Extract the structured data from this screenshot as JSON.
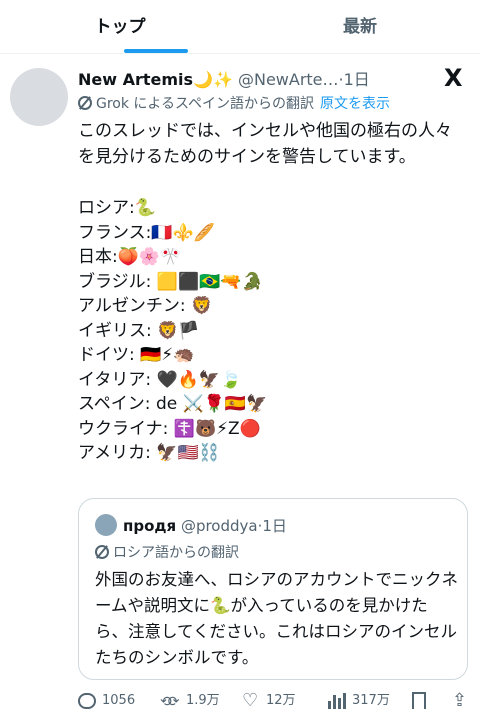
{
  "tabs": {
    "active": "トップ",
    "inactive": "最新"
  },
  "tweet": {
    "display_name": "New Artemis",
    "name_emoji": "🌙✨",
    "handle": "@NewArte…",
    "time": "·1日",
    "translate_label": "Grok によるスペイン語からの翻訳",
    "show_original": "原文を表示",
    "intro": "このスレッドでは、インセルや他国の極右の人々を見分けるためのサインを警告しています。",
    "signs": [
      "ロシア:🐍",
      "フランス:🇫🇷⚜️🥖",
      "日本:🍑🌸🎌",
      "ブラジル: 🟨⬛🇧🇷🔫🐊",
      "アルゼンチン: 🦁",
      "イギリス: 🦁🏴",
      "ドイツ: 🇩🇪⚡🦔",
      "イタリア: 🖤🔥🦅🍃",
      "スペイン: de ⚔️🌹🇪🇸🦅",
      "ウクライナ: ☦️🐻⚡Z🔴",
      "アメリカ: 🦅🇺🇸⛓️"
    ]
  },
  "quote": {
    "display_name": "продя",
    "handle": "@proddya",
    "time": "·1日",
    "translate_label": "ロシア語からの翻訳",
    "text": "外国のお友達へ、ロシアのアカウントでニックネームや説明文に🐍が入っているのを見かけたら、注意してください。これはロシアのインセルたちのシンボルです。"
  },
  "actions": {
    "replies": "1056",
    "reposts": "1.9万",
    "likes": "12万",
    "views": "317万"
  },
  "icons": {
    "logo": "X",
    "reply": "reply-icon",
    "repost": "repost-icon",
    "like": "heart-icon",
    "views": "views-icon",
    "bookmark": "bookmark-icon",
    "share": "share-icon"
  },
  "colors": {
    "accent": "#1d9bf0",
    "muted": "#536471",
    "text": "#0f1419"
  }
}
